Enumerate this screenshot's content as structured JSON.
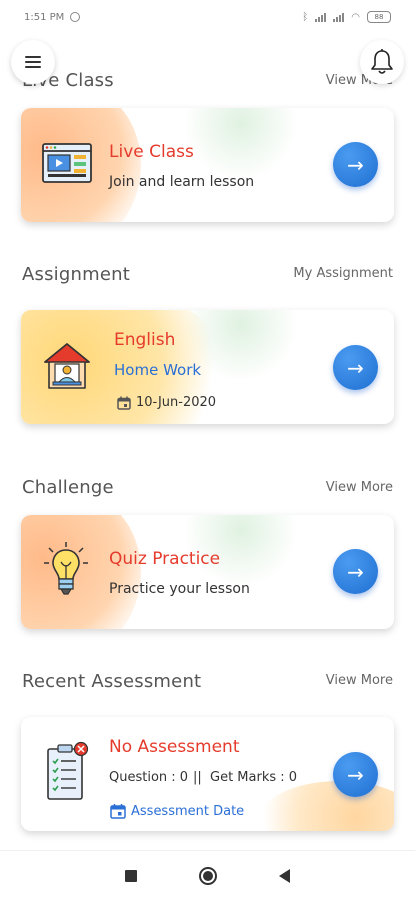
{
  "status_bar": {
    "time": "1:51 PM",
    "battery": "88"
  },
  "header": {
    "menu_icon": "hamburger-icon",
    "bell_icon": "bell-icon"
  },
  "live_class": {
    "section_title": "Live Class",
    "link": "View More",
    "card": {
      "title": "Live Class",
      "subtitle": "Join and learn lesson",
      "icon": "video-screen-icon"
    }
  },
  "assignment": {
    "section_title": "Assignment",
    "link": "My Assignment",
    "card": {
      "title": "English",
      "subtitle": "Home Work",
      "date": "10-Jun-2020",
      "icon": "home-teacher-icon"
    }
  },
  "challenge": {
    "section_title": "Challenge",
    "link": "View More",
    "card": {
      "title": "Quiz Practice",
      "subtitle": "Practice your lesson",
      "icon": "lightbulb-icon"
    }
  },
  "recent_assessment": {
    "section_title": "Recent Assessment",
    "link": "View More",
    "card": {
      "title": "No Assessment",
      "question_label": "Question : 0",
      "separator": "||",
      "marks_label": "Get Marks : 0",
      "date_label": "Assessment Date",
      "icon": "checklist-icon"
    }
  },
  "colors": {
    "accent_red": "#e53b2c",
    "accent_blue": "#1f6fd2",
    "link_blue": "#2a6fd6"
  }
}
